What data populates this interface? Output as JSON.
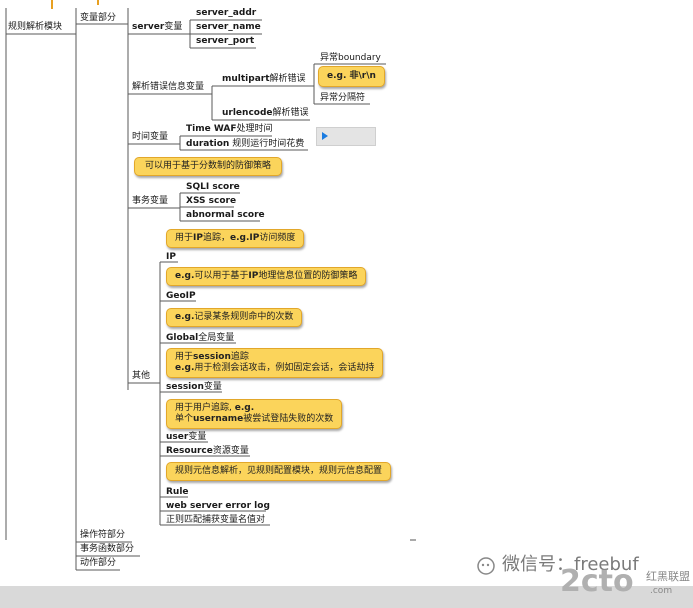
{
  "root": "规则解析模块",
  "branch_vars": "变量部分",
  "branch_ops": "操作符部分",
  "branch_funcs": "事务函数部分",
  "branch_actions": "动作部分",
  "server": {
    "label": "server",
    "suffix": "变量",
    "items": [
      "server_addr",
      "server_name",
      "server_port"
    ]
  },
  "parse": {
    "label": "解析错误信息变量",
    "multipart": "multipart",
    "multipart_suffix": "解析错误",
    "boundary": "异常boundary",
    "note": "e.g. 非\\r\\n",
    "separator": "异常分隔符",
    "urlencode": "urlencode",
    "urlencode_suffix": "解析错误"
  },
  "time": {
    "label": "时间变量",
    "waf": "Time WAF",
    "waf_suffix": "处理时间",
    "duration": "duration",
    "duration_suffix": " 规则运行时间花费"
  },
  "tx": {
    "note": "可以用于基于分数制的防御策略",
    "label": "事务变量",
    "items": [
      "SQLI score",
      "XSS score",
      "abnormal score"
    ]
  },
  "other": {
    "label": "其他",
    "ip_note_pre": "用于",
    "ip_note_bold": "IP",
    "ip_note_mid": "追踪，",
    "ip_note_bold2": "e.g.IP",
    "ip_note_post": "访问频度",
    "ip": "IP",
    "geo_note_pre": "e.g.",
    "geo_note_mid": "可以用于基于",
    "geo_note_bold": "IP",
    "geo_note_post": "地理信息位置的防御策略",
    "geo": "GeoIP",
    "global_note_pre": "e.g.",
    "global_note_post": "记录某条规则命中的次数",
    "global": "Global",
    "global_suffix": "全局变量",
    "session_note_l1_pre": "用于",
    "session_note_l1_bold": "session",
    "session_note_l1_post": "追踪",
    "session_note_l2_pre": "e.g.",
    "session_note_l2_post": "用于检测会话攻击，例如固定会话，会话劫持",
    "session": "session",
    "session_suffix": "变量",
    "user_note_l1_pre": "用于用户追踪, ",
    "user_note_l1_bold": "e.g.",
    "user_note_l2_pre": "单个",
    "user_note_l2_bold": "username",
    "user_note_l2_post": "被尝试登陆失败的次数",
    "user": "user",
    "user_suffix": "变量",
    "resource": "Resource",
    "resource_suffix": "资源变量",
    "rule_note": "规则元信息解析，见规则配置模块，规则元信息配置",
    "rule": "Rule",
    "weblog": "web server error log",
    "regex": "正则匹配捕获变量名值对"
  },
  "watermark": {
    "wechat": "微信号：freebuf",
    "logo": "2cto",
    "logo_sub": "红黑联盟",
    "logo_small": ".com"
  }
}
